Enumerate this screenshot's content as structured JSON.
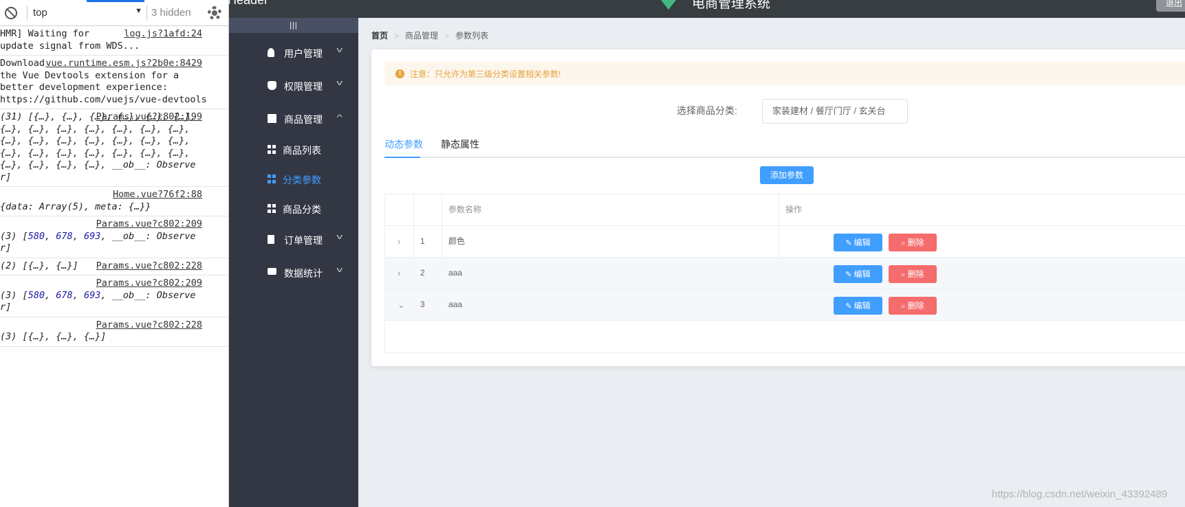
{
  "devtools": {
    "context": "top",
    "hidden_count": "3 hidden",
    "logs": [
      {
        "source": "log.js?1afd:24",
        "lines": [
          "HMR] Waiting for",
          "update signal from WDS..."
        ],
        "italic": false
      },
      {
        "source": "vue.runtime.esm.js?2b0e:8429",
        "lines": [
          "Download",
          "the Vue Devtools extension for a",
          "better development experience:",
          "https://github.com/vuejs/vue-devtools"
        ],
        "italic": false
      },
      {
        "source": "Params.vue?c802:199",
        "lines": [
          "(31) [{…}, {…}, {…}, {…}, {…}, {…},",
          "{…}, {…}, {…}, {…}, {…}, {…}, {…},",
          "{…}, {…}, {…}, {…}, {…}, {…}, {…},",
          "{…}, {…}, {…}, {…}, {…}, {…}, {…},",
          "{…}, {…}, {…}, {…}, __ob__: Observe",
          "r]"
        ],
        "italic": true
      },
      {
        "source": "Home.vue?76f2:88",
        "lines": [
          "",
          "{data: Array(5), meta: {…}}"
        ],
        "italic": true
      },
      {
        "source": "Params.vue?c802:209",
        "lines": [
          "",
          "(3) [580, 678, 693, __ob__: Observe",
          "r]"
        ],
        "italic": true
      },
      {
        "source": "Params.vue?c802:228",
        "lines": [
          "(2) [{…}, {…}]"
        ],
        "italic": true
      },
      {
        "source": "Params.vue?c802:209",
        "lines": [
          "",
          "(3) [580, 678, 693, __ob__: Observe",
          "r]"
        ],
        "italic": true
      },
      {
        "source": "Params.vue?c802:228",
        "lines": [
          "",
          "(3) [{…}, {…}, {…}]"
        ],
        "italic": true
      }
    ]
  },
  "header": {
    "left_text": "Header",
    "title": "电商管理系统",
    "logout_label": "退出"
  },
  "sidebar": {
    "toggle": "|||",
    "items": [
      {
        "label": "用户管理",
        "icon": "user-icon",
        "arrow": "⌄"
      },
      {
        "label": "权限管理",
        "icon": "shield-icon",
        "arrow": "⌄"
      },
      {
        "label": "商品管理",
        "icon": "bag-icon",
        "arrow": "⌃"
      },
      {
        "label": "商品列表",
        "icon": "grid-icon"
      },
      {
        "label": "分类参数",
        "icon": "grid-icon",
        "active": true
      },
      {
        "label": "商品分类",
        "icon": "grid-icon"
      },
      {
        "label": "订单管理",
        "icon": "clipboard-icon",
        "arrow": "⌄"
      },
      {
        "label": "数据统计",
        "icon": "chart-icon",
        "arrow": "⌄"
      }
    ]
  },
  "breadcrumb": [
    "首页",
    "商品管理",
    "参数列表"
  ],
  "alert": {
    "icon": "!",
    "text": "注意：只允许为第三级分类设置相关参数!"
  },
  "category_select": {
    "label": "选择商品分类:",
    "value": "家装建材 / 餐厅门厅 / 玄关台"
  },
  "tabs": [
    {
      "label": "动态参数",
      "active": true
    },
    {
      "label": "静态属性",
      "active": false
    }
  ],
  "add_button": "添加参数",
  "table": {
    "headers": [
      "",
      "",
      "参数名称",
      "操作"
    ],
    "rows": [
      {
        "expand": "›",
        "index": "1",
        "name": "颜色"
      },
      {
        "expand": "›",
        "index": "2",
        "name": "aaa"
      },
      {
        "expand": "⌄",
        "index": "3",
        "name": "aaa"
      }
    ],
    "edit_label": "编辑",
    "delete_label": "删除"
  },
  "watermark": "https://blog.csdn.net/weixin_43392489",
  "colors": {
    "primary": "#409eff",
    "danger": "#f56c6c",
    "warning": "#e6a23c",
    "sidebar_bg": "#333744",
    "header_bg": "#373d41",
    "main_bg": "#eaedf1"
  }
}
